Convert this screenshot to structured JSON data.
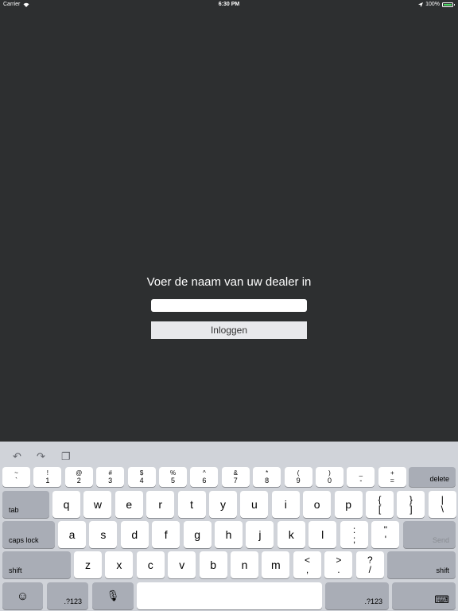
{
  "status_bar": {
    "carrier": "Carrier",
    "time": "6:30 PM",
    "battery": "100%"
  },
  "login": {
    "prompt": "Voer de naam van uw dealer in",
    "input_value": "",
    "button_label": "Inloggen"
  },
  "keyboard": {
    "toolbar": {
      "undo": "↶",
      "redo": "↷",
      "paste": "❐"
    },
    "number_row": [
      {
        "sym": "~",
        "dig": "`"
      },
      {
        "sym": "!",
        "dig": "1"
      },
      {
        "sym": "@",
        "dig": "2"
      },
      {
        "sym": "#",
        "dig": "3"
      },
      {
        "sym": "$",
        "dig": "4"
      },
      {
        "sym": "%",
        "dig": "5"
      },
      {
        "sym": "^",
        "dig": "6"
      },
      {
        "sym": "&",
        "dig": "7"
      },
      {
        "sym": "*",
        "dig": "8"
      },
      {
        "sym": "(",
        "dig": "9"
      },
      {
        "sym": ")",
        "dig": "0"
      },
      {
        "sym": "_",
        "dig": "-"
      },
      {
        "sym": "+",
        "dig": "="
      }
    ],
    "delete": "delete",
    "tab": "tab",
    "row_q": [
      "q",
      "w",
      "e",
      "r",
      "t",
      "y",
      "u",
      "i",
      "o",
      "p"
    ],
    "row_q_pairs": [
      {
        "top": "{",
        "bot": "["
      },
      {
        "top": "}",
        "bot": "]"
      },
      {
        "top": "|",
        "bot": "\\"
      }
    ],
    "caps_lock": "caps lock",
    "row_a": [
      "a",
      "s",
      "d",
      "f",
      "g",
      "h",
      "j",
      "k",
      "l"
    ],
    "row_a_pairs": [
      {
        "top": ":",
        "bot": ";"
      },
      {
        "top": "\"",
        "bot": "'"
      }
    ],
    "send": "Send",
    "shift": "shift",
    "row_z": [
      "z",
      "x",
      "c",
      "v",
      "b",
      "n",
      "m"
    ],
    "row_z_pairs": [
      {
        "top": "<",
        "bot": ","
      },
      {
        "top": ">",
        "bot": "."
      },
      {
        "top": "?",
        "bot": "/"
      }
    ],
    "emoji": "☺",
    "numbers_key": ".?123",
    "mic": "🎙",
    "space": "",
    "hide_keyboard": "⌨"
  }
}
